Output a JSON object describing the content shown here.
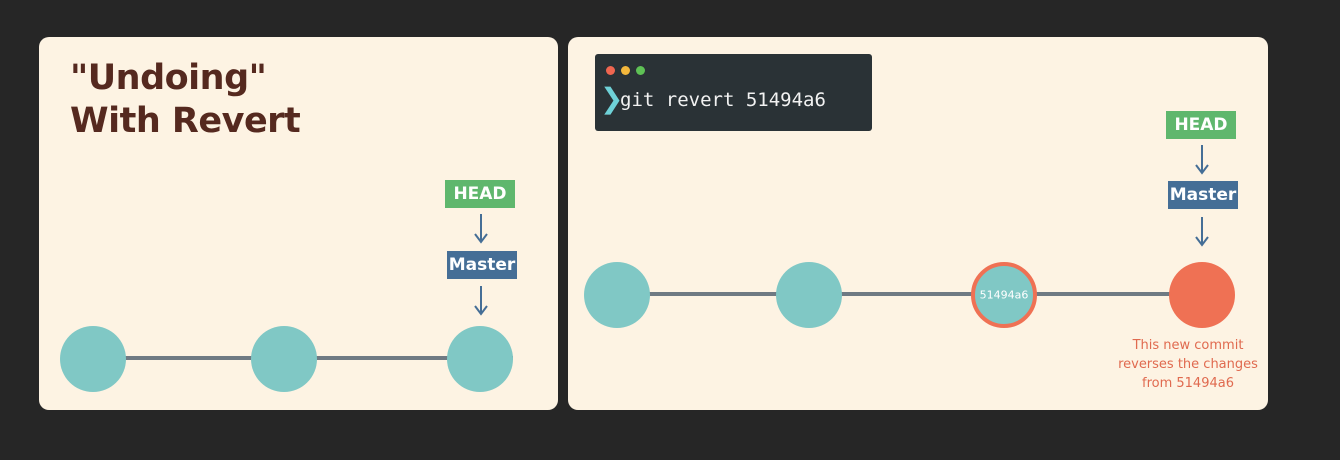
{
  "left_panel": {
    "title_line1": "\"Undoing\"",
    "title_line2": "With Revert",
    "head_label": "HEAD",
    "master_label": "Master"
  },
  "right_panel": {
    "terminal": {
      "prompt_glyph": "❯",
      "command": "git revert 51494a6"
    },
    "head_label": "HEAD",
    "master_label": "Master",
    "reverted_commit_label": "51494a6",
    "caption_lines": [
      "This new commit",
      "reverses the changes",
      "from 51494a6"
    ]
  },
  "colors": {
    "background": "#262626",
    "panel": "#fdf3e3",
    "commit_node": "#80c8c5",
    "new_commit": "#ef7154",
    "head_tag": "#5fb76d",
    "master_tag": "#456e96",
    "title_text": "#55291f",
    "terminal_bg": "#2a3236",
    "caption_text": "#e06a4f"
  }
}
